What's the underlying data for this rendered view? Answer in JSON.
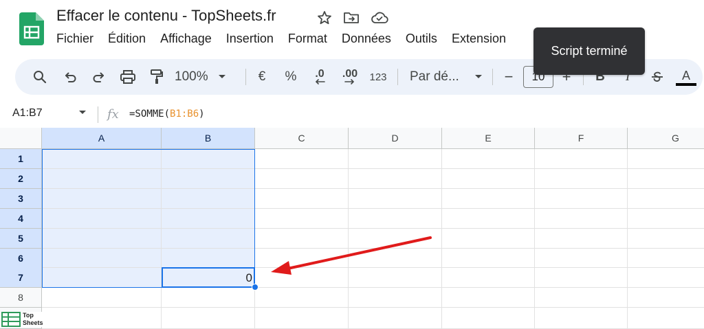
{
  "document": {
    "title": "Effacer le contenu - TopSheets.fr"
  },
  "menu": {
    "items": [
      "Fichier",
      "Édition",
      "Affichage",
      "Insertion",
      "Format",
      "Données",
      "Outils",
      "Extension"
    ]
  },
  "toolbar": {
    "zoom": "100%",
    "currency": "€",
    "percent": "%",
    "decrease_decimals": ".0",
    "increase_decimals": ".00",
    "number_format": "123",
    "font": "Par dé...",
    "font_size": "10",
    "minus": "−",
    "plus": "+",
    "bold": "B",
    "italic": "I",
    "text_color": "A",
    "text_color_value": "#000000"
  },
  "tooltip": {
    "text": "Script terminé"
  },
  "formula_bar": {
    "name_box": "A1:B7",
    "fx": "fx",
    "formula_prefix": "=SOMME(",
    "formula_ref": "B1:B6",
    "formula_suffix": ")"
  },
  "grid": {
    "columns": [
      "A",
      "B",
      "C",
      "D",
      "E",
      "F",
      "G"
    ],
    "rows": [
      "1",
      "2",
      "3",
      "4",
      "5",
      "6",
      "7",
      "8"
    ],
    "cell_B7": "0",
    "accent_color": "#1a73e8",
    "selection_fill": "#e7effd",
    "header_selected": "#d3e3fd"
  },
  "annotation": {
    "arrow_color": "#e01b1b"
  },
  "watermark": {
    "line1": "Top",
    "line2": "Sheets"
  }
}
